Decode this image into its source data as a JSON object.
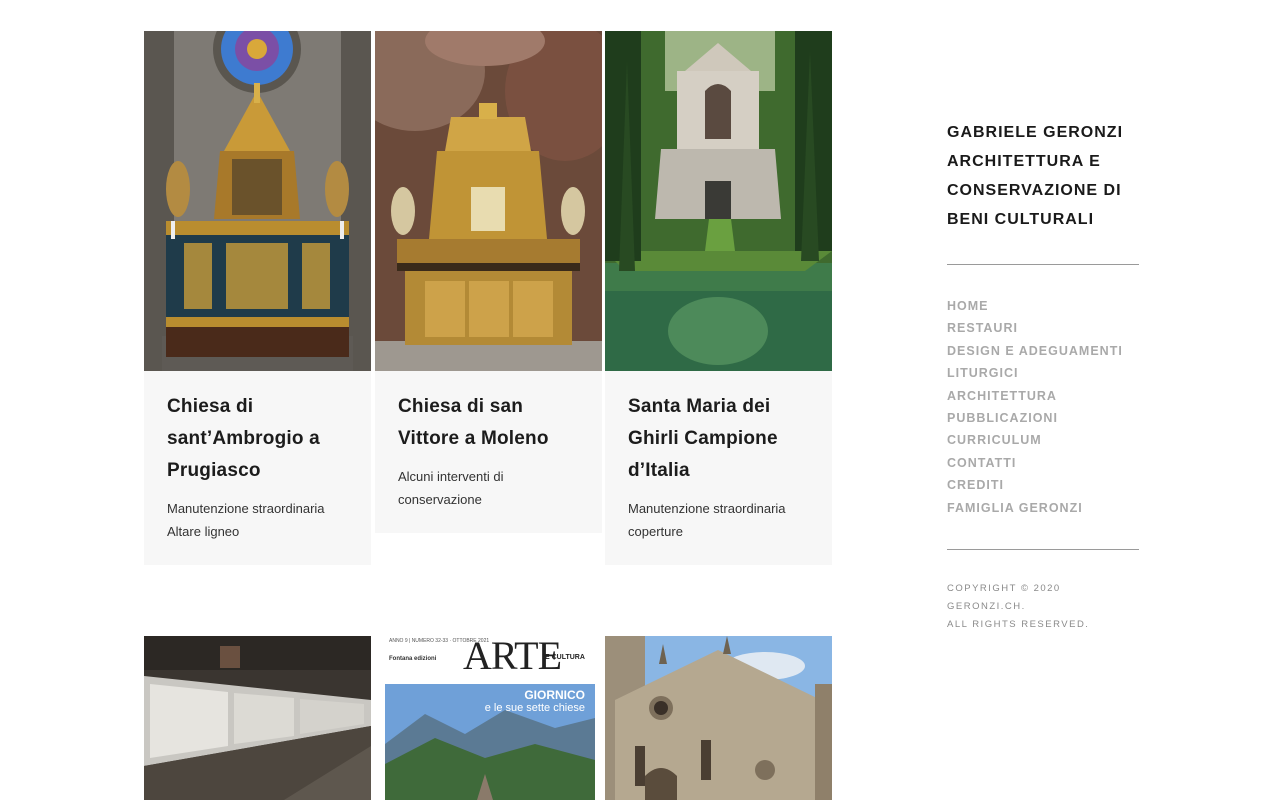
{
  "projects": [
    {
      "title": "Chiesa di sant’Ambrogio a Prugiasco",
      "desc_lines": [
        "Manutenzione straordinaria",
        "Altare ligneo"
      ]
    },
    {
      "title": "Chiesa di san Vittore a Moleno",
      "desc_lines": [
        "Alcuni interventi di",
        "conservazione"
      ]
    },
    {
      "title": "Santa Maria dei Ghirli Campione d’Italia",
      "desc_lines": [
        "Manutenzione straordinaria",
        "coperture"
      ]
    }
  ],
  "magazine": {
    "masthead": "ARTE",
    "masthead_sub": "E CULTURA",
    "issue": "ANNO 9 | NUMERO 32-33 · OTTOBRE 2021",
    "publisher": "Fontana edizioni",
    "cover_line1": "GIORNICO",
    "cover_line2": "e le sue sette chiese"
  },
  "sidebar": {
    "site_title": "GABRIELE GERONZI ARCHITETTURA E CONSERVAZIONE DI BENI CULTURALI",
    "nav": [
      "HOME",
      "RESTAURI",
      "DESIGN E ADEGUAMENTI",
      "LITURGICI",
      "ARCHITETTURA",
      "PUBBLICAZIONI",
      "CURRICULUM",
      "CONTATTI",
      "CREDITI",
      "FAMIGLIA GERONZI"
    ],
    "copyright_line1": "COPYRIGHT © 2020 GERONZI.CH.",
    "copyright_line2": "ALL RIGHTS RESERVED."
  }
}
